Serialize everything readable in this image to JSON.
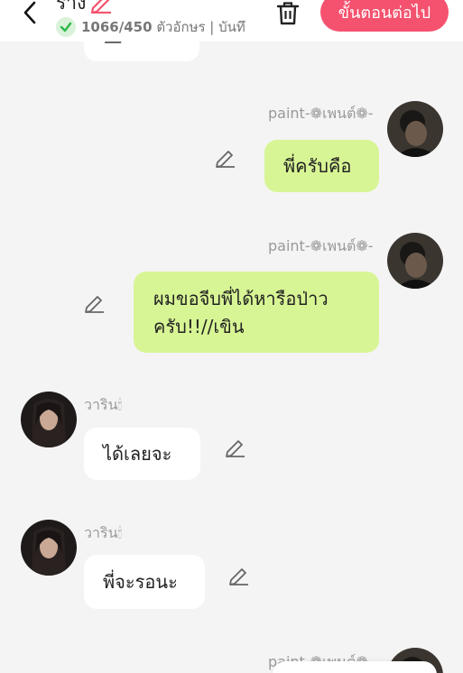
{
  "header": {
    "title": "ร่าง",
    "char_count": "1066/450",
    "status_suffix": " ตัวอักษร | บันทึ",
    "next_button": "ขั้นตอนต่อไป"
  },
  "colors": {
    "accent": "#f4526e",
    "right_bubble": "#d8f595",
    "left_bubble": "#ffffff",
    "background": "#f4f4f4"
  },
  "messages": [
    {
      "side": "right",
      "name": "paint-❁เพนต์❁-",
      "text": "พี่ครับคือ"
    },
    {
      "side": "right",
      "name": "paint-❁เพนต์❁-",
      "text_line1": "ผมขอจีบพี่ได้หารือป่าว",
      "text_line2": "ครับ!!//เขิน"
    },
    {
      "side": "left",
      "name": "วาริน",
      "name_emoji": "🕯",
      "text": "ได้เลยจะ"
    },
    {
      "side": "left",
      "name": "วาริน",
      "name_emoji": "🕯",
      "text": "พี่จะรอนะ"
    },
    {
      "side": "right",
      "name": "paint-❁เพนต์❁-"
    }
  ]
}
